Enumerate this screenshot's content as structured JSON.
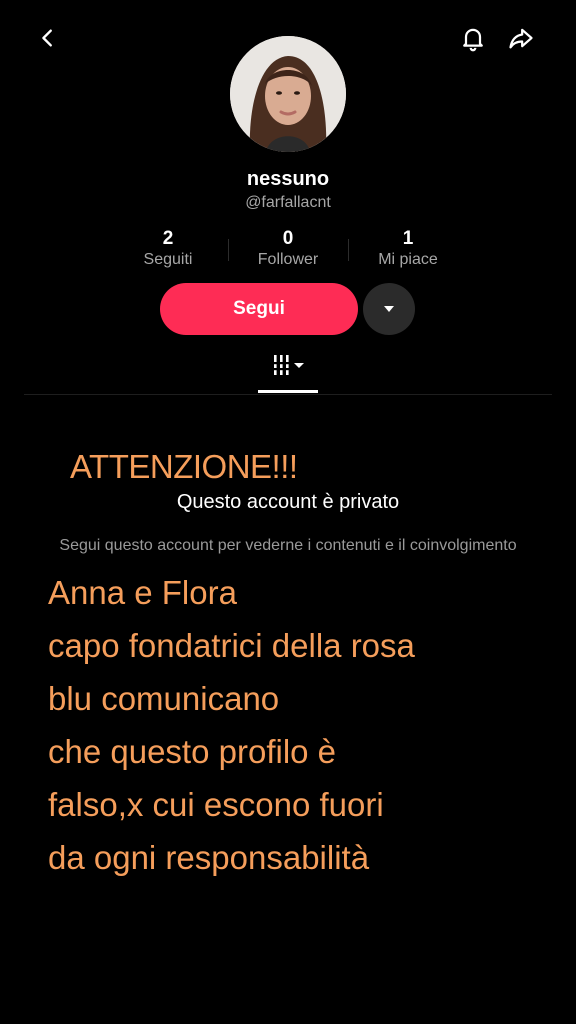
{
  "profile": {
    "name": "nessuno",
    "handle": "@farfallacnt"
  },
  "stats": [
    {
      "value": "2",
      "label": "Seguiti"
    },
    {
      "value": "0",
      "label": "Follower"
    },
    {
      "value": "1",
      "label": "Mi piace"
    }
  ],
  "actions": {
    "follow_label": "Segui"
  },
  "private": {
    "title": "Questo account è privato",
    "subtitle": "Segui questo account per vederne i contenuti e il coinvolgimento"
  },
  "overlay": {
    "title": "ATTENZIONE!!!",
    "lines": [
      "Anna e Flora",
      "capo fondatrici della rosa",
      "blu comunicano",
      "che questo profilo è",
      "falso,x cui escono fuori",
      "da ogni responsabilità"
    ]
  },
  "colors": {
    "accent": "#fe2c55",
    "overlay_text": "#f59e5b",
    "background": "#000000"
  }
}
